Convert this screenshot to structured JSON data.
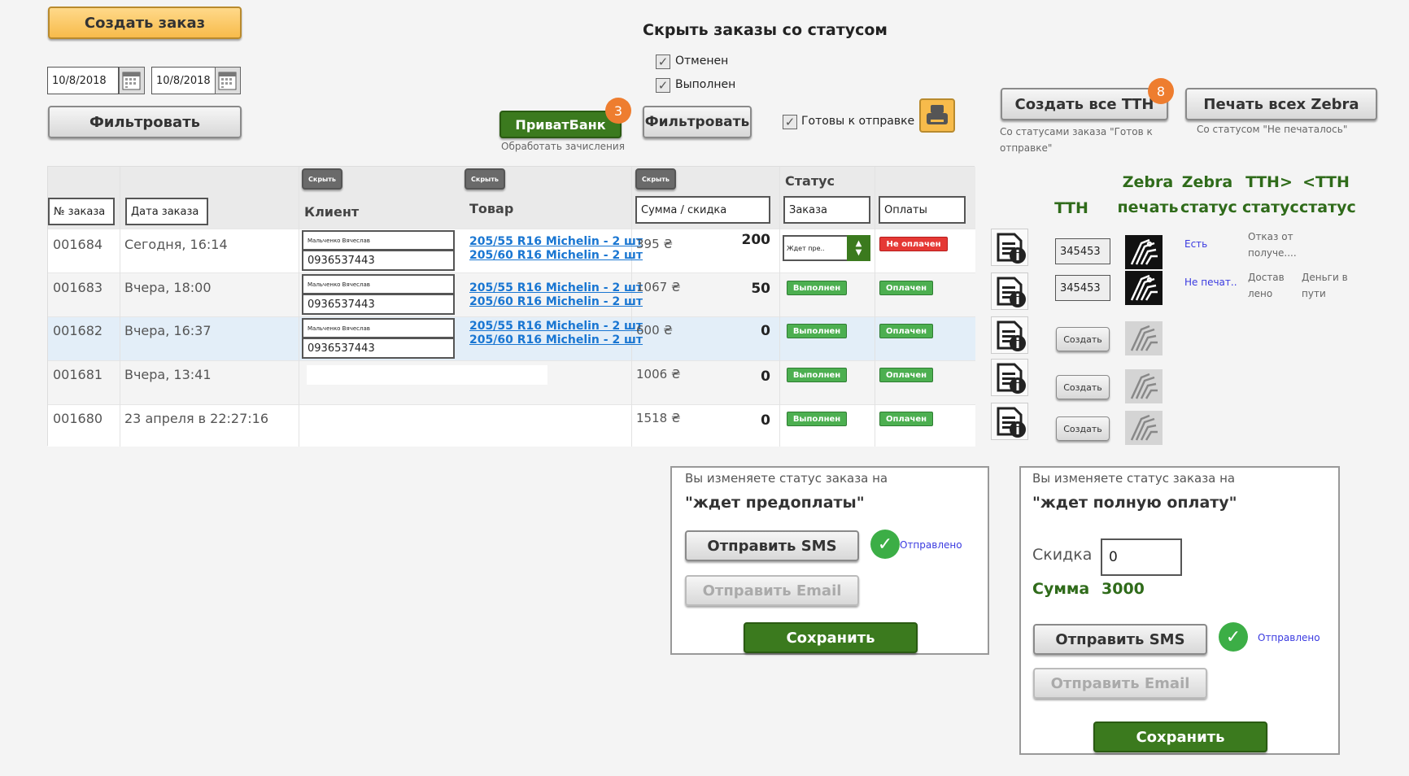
{
  "top": {
    "create_order": "Создать заказ",
    "date_from": "10/8/2018",
    "date_to": "10/8/2018",
    "filter": "Фильтровать"
  },
  "hide_status": {
    "title": "Скрыть заказы со статусом",
    "options": [
      {
        "label": "Отменен",
        "checked": true
      },
      {
        "label": "Выполнен",
        "checked": true
      }
    ]
  },
  "privat": {
    "label": "ПриватБанк",
    "badge": "3",
    "caption": "Обработать зачисления"
  },
  "filter2": "Фильтровать",
  "ready": {
    "label": "Готовы к отправке",
    "checked": true
  },
  "tth": {
    "create_all": "Создать все ТТН",
    "create_all_badge": "8",
    "create_all_caption": "Со статусами заказа \"Готов к отправке\"",
    "print_all": "Печать всех Zebra",
    "print_all_caption": "Со статусом \"Не печаталось\""
  },
  "columns": {
    "order_no": "№ заказа",
    "order_date": "Дата заказа",
    "client": "Клиент",
    "goods": "Товар",
    "sum": "Сумма / скидка",
    "status": "Статус",
    "order_status": "Заказа",
    "payment_status": "Оплаты",
    "hide": "Скрыть"
  },
  "right_headers": {
    "tth": "ТТН",
    "zebra_print": [
      "Zebra",
      "печать"
    ],
    "zebra_status": [
      "Zebra",
      "статус"
    ],
    "tth_out": [
      "ТТН>",
      "статус"
    ],
    "tth_in": [
      "<ТТН",
      "статус"
    ]
  },
  "rows": [
    {
      "no": "001684",
      "date": "Сегодня, 16:14",
      "client_name": "Мальченко Вячеслав",
      "client_phone": "0936537443",
      "goods": [
        "205/55 R16 Michelin - 2 шт",
        "205/60 R16 Michelin - 2 шт"
      ],
      "sum": "395 ₴",
      "discount": "200",
      "order_status": "Ждет пре..",
      "payment_status": "Не оплачен",
      "tth": "345453",
      "zebra_status": "Есть",
      "tth_out": [
        "Отказ от",
        "получе...."
      ],
      "tth_in": []
    },
    {
      "no": "001683",
      "date": "Вчера, 18:00",
      "client_name": "Мальченко Вячеслав",
      "client_phone": "0936537443",
      "goods": [
        "205/55 R16 Michelin - 2 шт",
        "205/60 R16 Michelin - 2 шт"
      ],
      "sum": "1067 ₴",
      "discount": "50",
      "order_status": "Выполнен",
      "payment_status": "Оплачен",
      "tth": "345453",
      "zebra_status": "Не печат..",
      "tth_out": [
        "Достав",
        "лено"
      ],
      "tth_in": [
        "Деньги в",
        "пути"
      ]
    },
    {
      "no": "001682",
      "date": "Вчера, 16:37",
      "client_name": "Мальченко Вячеслав",
      "client_phone": "0936537443",
      "goods": [
        "205/55 R16 Michelin - 2 шт",
        "205/60 R16 Michelin - 2 шт"
      ],
      "sum": "600 ₴",
      "discount": "0",
      "order_status": "Выполнен",
      "payment_status": "Оплачен",
      "tth_button": "Создать"
    },
    {
      "no": "001681",
      "date": "Вчера, 13:41",
      "sum": "1006 ₴",
      "discount": "0",
      "order_status": "Выполнен",
      "payment_status": "Оплачен",
      "tth_button": "Создать"
    },
    {
      "no": "001680",
      "date": "23 апреля в 22:27:16",
      "sum": "1518 ₴",
      "discount": "0",
      "order_status": "Выполнен",
      "payment_status": "Оплачен",
      "tth_button": "Создать"
    }
  ],
  "panel1": {
    "intro": "Вы изменяете статус заказа на",
    "status": "\"ждет предоплаты\"",
    "send_sms": "Отправить SMS",
    "sent": "Отправлено",
    "send_email": "Отправить Email",
    "save": "Сохранить"
  },
  "panel2": {
    "intro": "Вы изменяете статус заказа на",
    "status": "\"ждет полную оплату\"",
    "discount_label": "Скидка",
    "discount_value": "0",
    "sum_label": "Сумма",
    "sum_value": "3000",
    "send_sms": "Отправить SMS",
    "sent": "Отправлено",
    "send_email": "Отправить Email",
    "save": "Сохранить"
  }
}
